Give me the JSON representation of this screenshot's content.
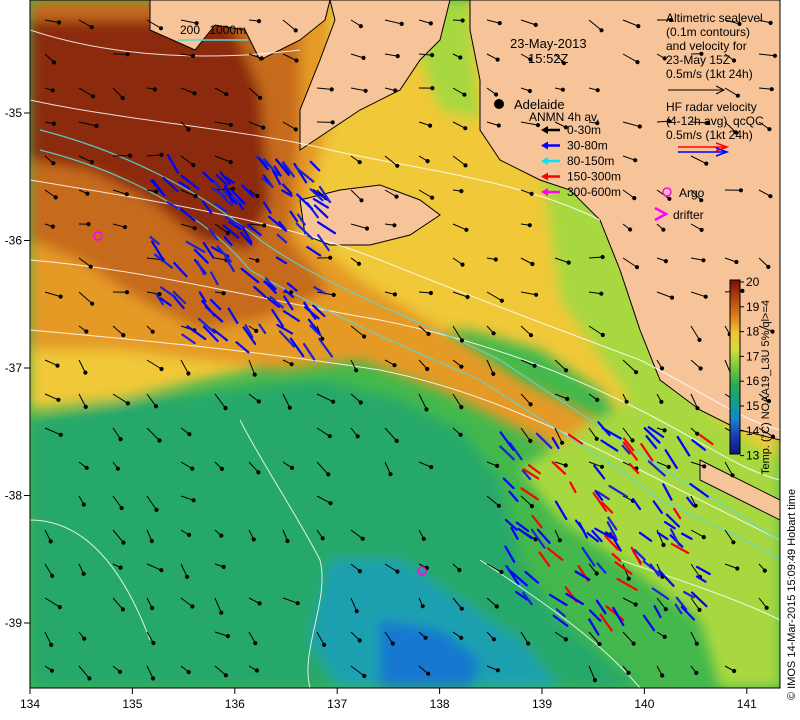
{
  "datetime": {
    "date": "23-May-2013",
    "time": "15:52Z"
  },
  "depth_contours": {
    "labels": [
      "200",
      "1000m"
    ]
  },
  "city": {
    "name": "Adelaide"
  },
  "altimetry_legend": {
    "lines": [
      "Altimetric sealevel",
      "(0.1m contours)",
      "and velocity for",
      "23-May 15Z",
      "0.5m/s (1kt 24h)"
    ]
  },
  "hf_radar_legend": {
    "lines": [
      "HF radar velocity",
      "(4-12h avg)",
      "0.5m/s (1kt 24h)"
    ],
    "overlap_text": "qcQC"
  },
  "anmn_legend": {
    "title": "ANMN 4h av.",
    "items": [
      {
        "label": "0-30m",
        "color": "#000000"
      },
      {
        "label": "30-80m",
        "color": "#0000ff"
      },
      {
        "label": "80-150m",
        "color": "#00e5ff"
      },
      {
        "label": "150-300m",
        "color": "#ff0000"
      },
      {
        "label": "300-600m",
        "color": "#ff00ff"
      }
    ]
  },
  "markers": {
    "argo": "Argo",
    "drifter": "drifter"
  },
  "colorbar": {
    "label": "Temp. (°C) NOAA19_L3U 5% ql>=4",
    "ticks": [
      "20",
      "19",
      "18",
      "17",
      "16",
      "15",
      "14",
      "13"
    ],
    "colors": [
      "#7a0c06",
      "#b2420f",
      "#d97a1a",
      "#eec234",
      "#d4dc3a",
      "#7cc83c",
      "#2eaa52",
      "#13a088",
      "#1a84c8",
      "#1b3ab0",
      "#0a1a80"
    ]
  },
  "axes": {
    "x_ticks": [
      "134",
      "135",
      "136",
      "137",
      "138",
      "139",
      "140",
      "141"
    ],
    "y_ticks": [
      "-35",
      "-36",
      "-37",
      "-38",
      "-39"
    ]
  },
  "credit": "© IMOS 14-Mar-2015 15:09:49 Hobart time",
  "palette": {
    "land": "#f7c49a",
    "warm_dark": "#8c2a0a",
    "warm": "#c66a1a",
    "orange": "#e59a28",
    "yellow": "#f0c838",
    "lime": "#a8d840",
    "green": "#44b84c",
    "teal": "#26a86a",
    "cyan": "#1aa0b0",
    "blue": "#1878d0"
  }
}
